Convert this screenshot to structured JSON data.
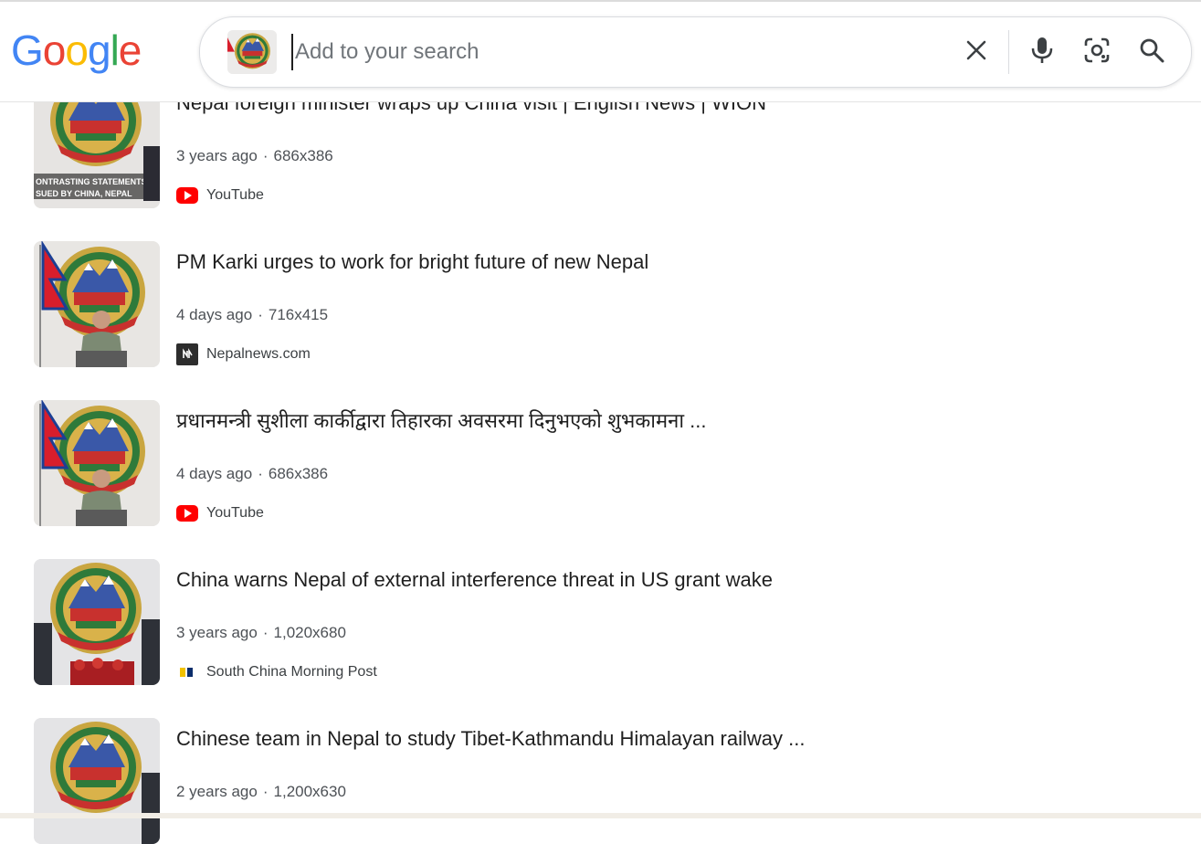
{
  "header": {
    "logo_letters": [
      "G",
      "o",
      "o",
      "g",
      "l",
      "e"
    ],
    "logo_colors": [
      "#4285F4",
      "#EA4335",
      "#FBBC05",
      "#4285F4",
      "#34A853",
      "#EA4335"
    ],
    "search": {
      "placeholder": "Add to your search",
      "value": ""
    },
    "icons": [
      "close-icon",
      "microphone-icon",
      "lens-icon",
      "search-icon"
    ]
  },
  "results": [
    {
      "title": "Nepal foreign minister wraps up China visit | English News | WION",
      "age": "3 years ago",
      "dimensions": "686x386",
      "source": "YouTube",
      "source_icon": "youtube-icon",
      "overlay_lines": [
        "ONTRASTING STATEMENTS",
        "SUED BY CHINA, NEPAL"
      ]
    },
    {
      "title": "PM Karki urges to work for bright future of new Nepal",
      "age": "4 days ago",
      "dimensions": "716x415",
      "source": "Nepalnews.com",
      "source_icon": "nepalnews-icon"
    },
    {
      "title": "प्रधानमन्त्री सुशीला कार्कीद्वारा तिहारका अवसरमा दिनुभएको शुभकामना ...",
      "age": "4 days ago",
      "dimensions": "686x386",
      "source": "YouTube",
      "source_icon": "youtube-icon"
    },
    {
      "title": "China warns Nepal of external interference threat in US grant wake",
      "age": "3 years ago",
      "dimensions": "1,020x680",
      "source": "South China Morning Post",
      "source_icon": "scmp-icon"
    },
    {
      "title": "Chinese team in Nepal to study Tibet-Kathmandu Himalayan railway ...",
      "age": "2 years ago",
      "dimensions": "1,200x630",
      "source": "",
      "source_icon": ""
    }
  ],
  "colors": {
    "youtube": "#FF0000",
    "text": "#1f1f1f",
    "meta": "#4d5156"
  }
}
